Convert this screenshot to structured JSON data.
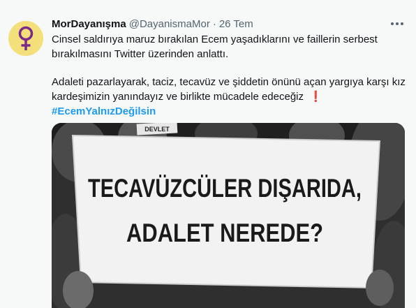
{
  "tweet": {
    "author_name": "MorDayanışma",
    "author_handle": "@DayanismaMor",
    "separator": "·",
    "date": "26 Tem",
    "body_lines": [
      "Cinsel saldırıya maruz bırakılan Ecem yaşadıklarını ve faillerin serbest",
      "bırakılmasını Twitter üzerinden anlattı."
    ],
    "body2_lines": [
      "Adaleti pazarlayarak, taciz, tecavüz ve şiddetin önünü açan yargıya karşı kız",
      "kardeşimizin yanındayız ve birlikte mücadele edeceğiz"
    ],
    "emoji": "❗",
    "hashtag": "#EcemYalnızDeğilsin"
  },
  "media": {
    "sign_line1": "TECAVÜZCÜLER DIŞARIDA,",
    "sign_line2": "ADALET NEREDE?",
    "small_sign": "DEVLET"
  },
  "icons": {
    "avatar": "female-symbol-icon",
    "more": "more-options-icon"
  },
  "colors": {
    "background": "#f7f9f9",
    "hashtag": "#1d9bf0",
    "secondary_text": "#536471",
    "avatar_bg": "#f3e07a",
    "avatar_symbol": "#7a2a8a"
  }
}
